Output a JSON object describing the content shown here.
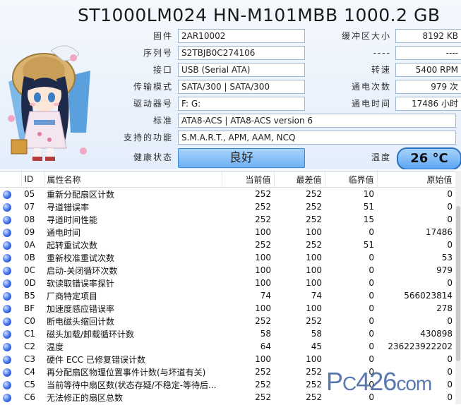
{
  "title": "ST1000LM024 HN-M101MBB 1000.2 GB",
  "info_left": [
    {
      "label": "固件",
      "value": "2AR10002"
    },
    {
      "label": "序列号",
      "value": "S2TBJB0C274106"
    },
    {
      "label": "接口",
      "value": "USB (Serial ATA)"
    },
    {
      "label": "传输模式",
      "value": "SATA/300 | SATA/300"
    },
    {
      "label": "驱动器号",
      "value": "F: G:"
    }
  ],
  "info_right": [
    {
      "label": "缓冲区大小",
      "value": "8192 KB"
    },
    {
      "label": "----",
      "value": "----"
    },
    {
      "label": "转速",
      "value": "5400 RPM"
    },
    {
      "label": "通电次数",
      "value": "979 次"
    },
    {
      "label": "通电时间",
      "value": "17486 小时"
    }
  ],
  "standard": {
    "label": "标准",
    "value": "ATA8-ACS | ATA8-ACS version 6"
  },
  "features": {
    "label": "支持的功能",
    "value": "S.M.A.R.T., APM, AAM, NCQ"
  },
  "health": {
    "label": "健康状态",
    "value": "良好"
  },
  "temperature": {
    "label": "温度",
    "value": "26 °C"
  },
  "table": {
    "headers": [
      "",
      "ID",
      "属性名称",
      "当前值",
      "最差值",
      "临界值",
      "原始值"
    ],
    "rows": [
      {
        "id": "05",
        "name": "重新分配扇区计数",
        "cur": "252",
        "worst": "252",
        "thr": "10",
        "raw": "0"
      },
      {
        "id": "07",
        "name": "寻道错误率",
        "cur": "252",
        "worst": "252",
        "thr": "51",
        "raw": "0"
      },
      {
        "id": "08",
        "name": "寻道时间性能",
        "cur": "252",
        "worst": "252",
        "thr": "15",
        "raw": "0"
      },
      {
        "id": "09",
        "name": "通电时间",
        "cur": "100",
        "worst": "100",
        "thr": "0",
        "raw": "17486"
      },
      {
        "id": "0A",
        "name": "起转重试次数",
        "cur": "252",
        "worst": "252",
        "thr": "51",
        "raw": "0"
      },
      {
        "id": "0B",
        "name": "重新校准重试次数",
        "cur": "100",
        "worst": "100",
        "thr": "0",
        "raw": "53"
      },
      {
        "id": "0C",
        "name": "启动-关闭循环次数",
        "cur": "100",
        "worst": "100",
        "thr": "0",
        "raw": "979"
      },
      {
        "id": "0D",
        "name": "软读取错误率探针",
        "cur": "100",
        "worst": "100",
        "thr": "0",
        "raw": "0"
      },
      {
        "id": "B5",
        "name": "厂商特定项目",
        "cur": "74",
        "worst": "74",
        "thr": "0",
        "raw": "566023814"
      },
      {
        "id": "BF",
        "name": "加速度感应错误率",
        "cur": "100",
        "worst": "100",
        "thr": "0",
        "raw": "278"
      },
      {
        "id": "C0",
        "name": "断电磁头缩回计数",
        "cur": "252",
        "worst": "252",
        "thr": "0",
        "raw": "0"
      },
      {
        "id": "C1",
        "name": "磁头加载/卸载循环计数",
        "cur": "58",
        "worst": "58",
        "thr": "0",
        "raw": "430898"
      },
      {
        "id": "C2",
        "name": "温度",
        "cur": "64",
        "worst": "45",
        "thr": "0",
        "raw": "236223922202"
      },
      {
        "id": "C3",
        "name": "硬件 ECC 已修复错误计数",
        "cur": "100",
        "worst": "100",
        "thr": "0",
        "raw": "0"
      },
      {
        "id": "C4",
        "name": "再分配扇区物理位置事件计数(与坏道有关)",
        "cur": "252",
        "worst": "252",
        "thr": "0",
        "raw": "0"
      },
      {
        "id": "C5",
        "name": "当前等待中扇区数(状态存疑/不稳定-等待后...",
        "cur": "252",
        "worst": "252",
        "thr": "0",
        "raw": "0"
      },
      {
        "id": "C6",
        "name": "无法修正的扇区总数",
        "cur": "252",
        "worst": "252",
        "thr": "0",
        "raw": "0"
      }
    ]
  },
  "watermark": "PC426com",
  "colors": {
    "status_dot": "#3d6ee8",
    "health_bg": "#8fc4f8",
    "temp_border": "#2a6fbf"
  }
}
